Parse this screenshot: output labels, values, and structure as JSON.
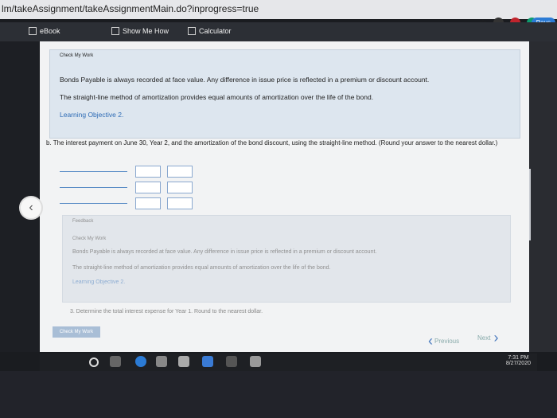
{
  "browser": {
    "url": "lm/takeAssignment/takeAssignmentMain.do?inprogress=true",
    "profile_label": "Paus"
  },
  "toolbar": {
    "ebook": "eBook",
    "show_me_how": "Show Me How",
    "calculator": "Calculator"
  },
  "feedback_top": {
    "header": "Check My Work",
    "line1": "Bonds Payable is always recorded at face value. Any difference in issue price is reflected in a premium or discount account.",
    "line2": "The straight-line method of amortization provides equal amounts of amortization over the life of the bond.",
    "learning_objective": "Learning Objective 2."
  },
  "question_b": {
    "text": "b. The interest payment on June 30, Year 2, and the amortization of the bond discount, using the straight-line method. (Round your answer to the nearest dollar.)"
  },
  "feedback_bottom": {
    "label": "Feedback",
    "header": "Check My Work",
    "line1": "Bonds Payable is always recorded at face value. Any difference in issue price is reflected in a premium or discount account.",
    "line2": "The straight-line method of amortization provides equal amounts of amortization over the life of the bond.",
    "learning_objective": "Learning Objective 2."
  },
  "question_3": {
    "text": "3. Determine the total interest expense for Year 1. Round to the nearest dollar."
  },
  "nav": {
    "check_my_work": "Check My Work",
    "previous": "Previous",
    "next": "Next"
  },
  "taskbar": {
    "time": "7:31 PM",
    "date": "8/27/2020"
  },
  "colors": {
    "feedback_bg": "#dde6ef",
    "accent_blue": "#2d6bb5",
    "toolbar_bg": "#2c2f35"
  }
}
